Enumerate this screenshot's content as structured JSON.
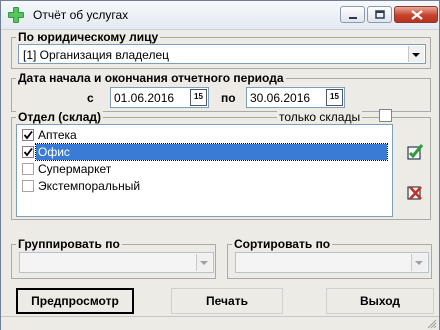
{
  "window": {
    "title": "Отчёт об услугах",
    "icon": "green-plus-icon",
    "controls": [
      "minimize-icon",
      "maximize-icon",
      "close-icon"
    ]
  },
  "legal_entity": {
    "label": "По юридическому лицу",
    "selected": "[1] Организация владелец"
  },
  "period": {
    "label": "Дата начала и окончания отчетного периода",
    "from_label": "с",
    "from_value": "01.06.2016",
    "to_label": "по",
    "to_value": "30.06.2016",
    "calendar_button_text": "15"
  },
  "departments": {
    "label": "Отдел (склад)",
    "only_warehouses_label": "только склады",
    "only_warehouses_checked": false,
    "items": [
      {
        "label": "Аптека",
        "checked": true,
        "selected": false
      },
      {
        "label": "Офис",
        "checked": true,
        "selected": true
      },
      {
        "label": "Супермаркет",
        "checked": false,
        "selected": false
      },
      {
        "label": "Экстемпоральный",
        "checked": false,
        "selected": false
      }
    ],
    "check_all_icon": "check-all-icon",
    "uncheck_all_icon": "uncheck-all-icon"
  },
  "group_by": {
    "label": "Группировать по",
    "selected": ""
  },
  "sort_by": {
    "label": "Сортировать по",
    "selected": ""
  },
  "buttons": {
    "preview": "Предпросмотр",
    "print": "Печать",
    "exit": "Выход"
  },
  "colors": {
    "selection": "#3a7bd5",
    "dialog_bg": "#ecebe6",
    "close_button": "#c7422c"
  }
}
